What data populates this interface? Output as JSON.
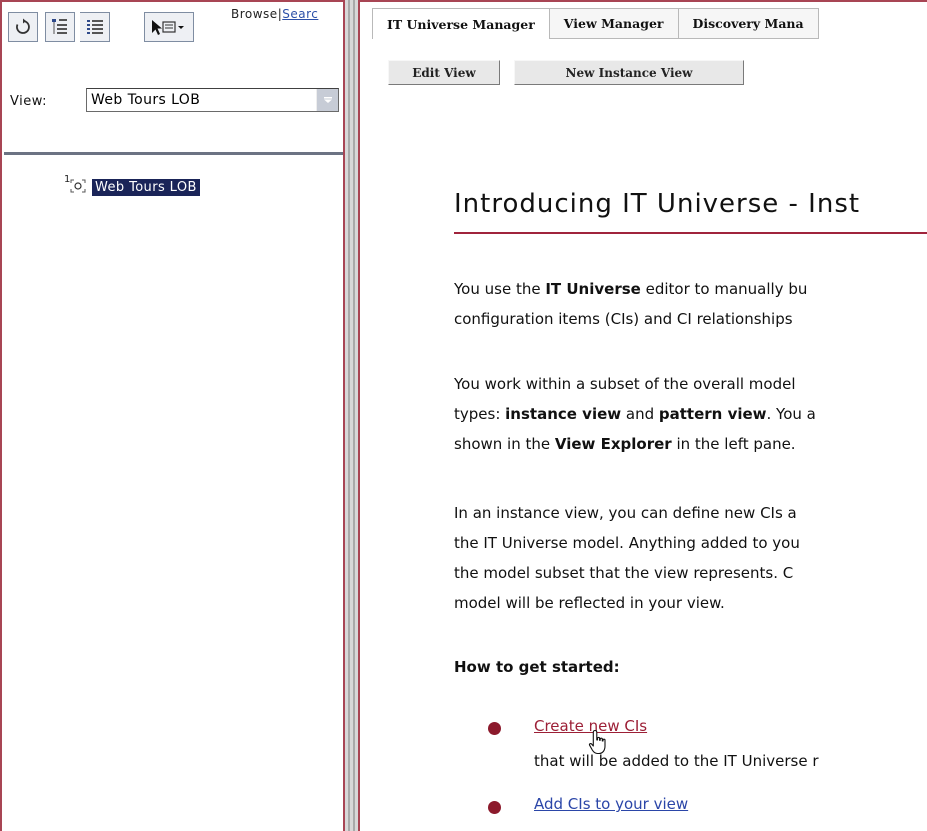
{
  "left_pane": {
    "toolbar": {
      "buttons": [
        {
          "name": "refresh",
          "icon": "refresh-icon"
        },
        {
          "name": "tree-view",
          "icon": "tree-view-icon"
        },
        {
          "name": "list-view",
          "icon": "list-view-icon"
        },
        {
          "name": "actions-menu",
          "icon": "actions-dropdown-icon"
        }
      ]
    },
    "browse_label": "Browse",
    "separator": "|",
    "search_label": "Searc",
    "view_label": "View:",
    "view_selected": "Web Tours LOB",
    "tree": {
      "node_badge": "1",
      "node_label": "Web Tours LOB"
    }
  },
  "right_pane": {
    "tabs": [
      {
        "label": "IT Universe Manager",
        "active": true
      },
      {
        "label": "View Manager",
        "active": false
      },
      {
        "label": "Discovery Mana",
        "active": false
      }
    ],
    "buttons": {
      "edit_view": "Edit View",
      "new_instance_view": "New Instance View"
    },
    "content": {
      "title": "Introducing IT Universe - Inst",
      "para1": {
        "l1_a": "You use the ",
        "l1_b": "IT Universe",
        "l1_c": " editor to manually bu",
        "l2": "configuration items (CIs) and CI relationships"
      },
      "para2": {
        "l1": "You work within a subset of the overall model",
        "l2_a": "types: ",
        "l2_b": "instance view",
        "l2_c": " and ",
        "l2_d": "pattern view",
        "l2_e": ". You a",
        "l3_a": "shown in the ",
        "l3_b": "View Explorer",
        "l3_c": " in the left pane."
      },
      "para3": {
        "l1": "In an instance view, you can define new CIs a",
        "l2": "the IT Universe model. Anything added to you",
        "l3": "the model subset that the view represents. C",
        "l4": "model will be reflected in your view."
      },
      "how_to_heading": "How to get started:",
      "bullets": [
        {
          "link": "Create new CIs",
          "desc": "that will be added to the IT Universe r"
        },
        {
          "link": "Add CIs to your view"
        }
      ]
    }
  },
  "colors": {
    "frame_accent": "#a84554",
    "title_rule": "#a0243c",
    "bullet": "#8c1a2c",
    "link_visited": "#9c1f36",
    "link": "#2b46a8",
    "tree_selection": "#1a2458"
  }
}
